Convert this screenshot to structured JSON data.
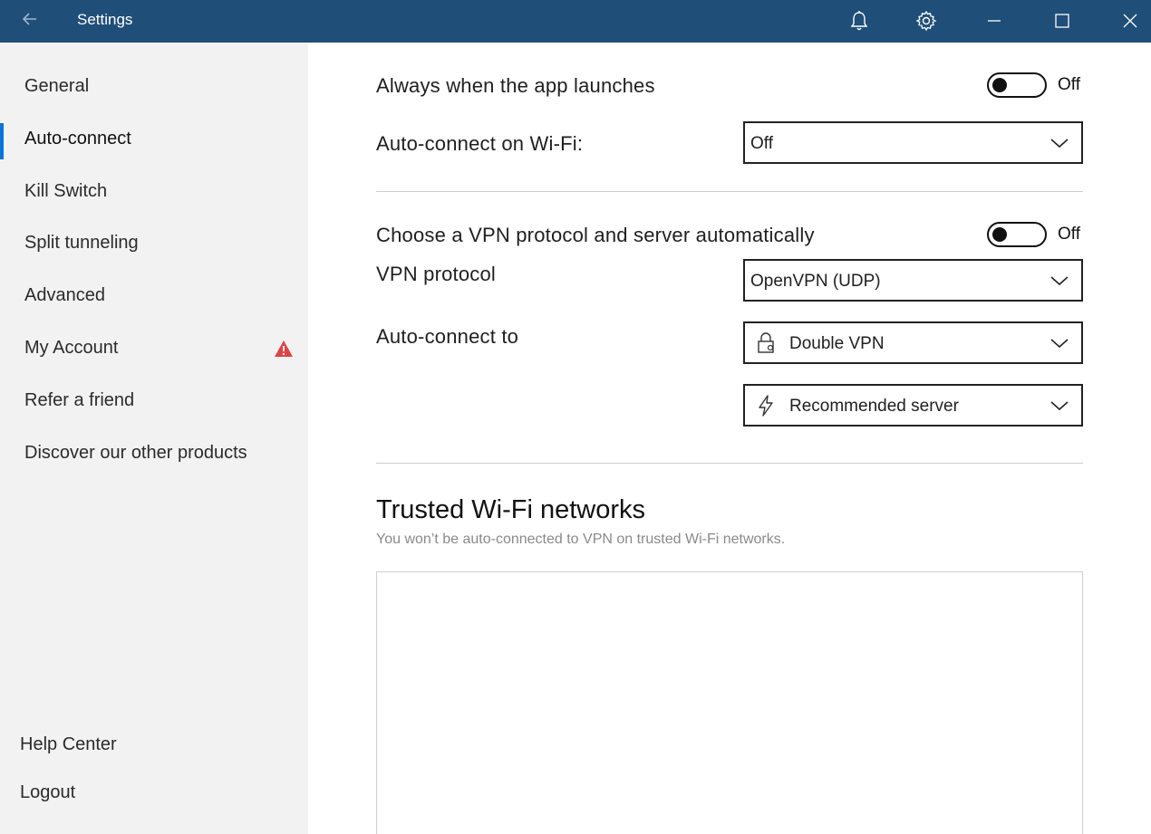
{
  "titlebar": {
    "title": "Settings",
    "background": "#1f4e79"
  },
  "sidebar": {
    "items": [
      {
        "label": "General"
      },
      {
        "label": "Auto-connect",
        "active": true
      },
      {
        "label": "Kill Switch"
      },
      {
        "label": "Split tunneling"
      },
      {
        "label": "Advanced"
      },
      {
        "label": "My Account",
        "badge": "warning-icon"
      },
      {
        "label": "Refer a friend"
      },
      {
        "label": "Discover our other products"
      }
    ],
    "footer": [
      {
        "label": "Help Center"
      },
      {
        "label": "Logout"
      }
    ],
    "accent": "#0a74da",
    "warning_color": "#e04343"
  },
  "main": {
    "launch": {
      "label": "Always when the app launches",
      "toggle": "Off"
    },
    "wifi": {
      "label": "Auto-connect on Wi-Fi:",
      "value": "Off"
    },
    "auto_protocol": {
      "label": "Choose a VPN protocol and server automatically",
      "toggle": "Off"
    },
    "protocol": {
      "label": "VPN protocol",
      "value": "OpenVPN (UDP)"
    },
    "connect_to": {
      "label": "Auto-connect to",
      "server_type": {
        "icon": "lock-icon",
        "value": "Double VPN"
      },
      "server": {
        "icon": "lightning-icon",
        "value": "Recommended server"
      }
    },
    "trusted": {
      "title": "Trusted Wi-Fi networks",
      "subtitle": "You won’t be auto-connected to VPN on trusted Wi-Fi networks."
    }
  }
}
